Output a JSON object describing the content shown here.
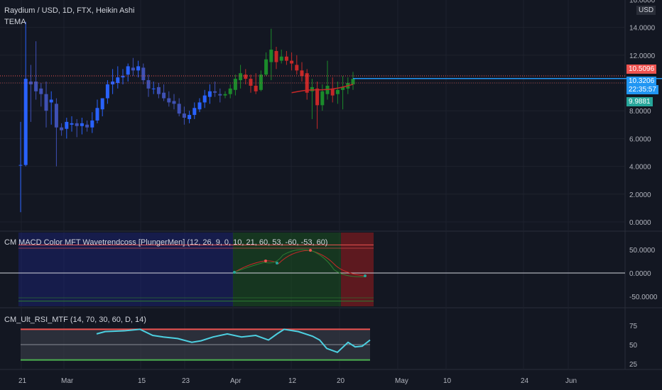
{
  "main": {
    "title": "Raydium / USD, 1D, FTX, Heikin Ashi",
    "indicator": "TEMA",
    "currency": "USD",
    "y_ticks": [
      "16.0000",
      "14.0000",
      "12.0000",
      "8.0000",
      "6.0000",
      "4.0000",
      "2.0000",
      "0.0000"
    ],
    "badges": {
      "upper": "10.5096",
      "price": "10.3206",
      "countdown": "22:35:57",
      "lower": "9.9881"
    },
    "colors": {
      "up": "#26a69a",
      "down": "#ef5350",
      "blue": "#2962ff",
      "green": "#1b8a2b",
      "red": "#d32f2f",
      "hline": "#2196f3"
    }
  },
  "macd": {
    "title": "CM MACD Color MFT Wavetrendcoss [PlungerMen] (12, 26, 9, 0, 10, 21, 60, 53, -60, -53, 60)",
    "y_ticks": [
      "50.0000",
      "0.0000",
      "-50.0000"
    ]
  },
  "rsi": {
    "title": "CM_Ult_RSI_MTF (14, 70, 30, 60, D, 14)",
    "y_ticks": [
      "75",
      "50",
      "25"
    ]
  },
  "x_ticks": [
    "21",
    "Mar",
    "15",
    "23",
    "Apr",
    "12",
    "20",
    "May",
    "10",
    "24",
    "Jun"
  ],
  "chart_data": {
    "type": "candlestick",
    "title": "Raydium / USD, 1D, FTX, Heikin Ashi",
    "ylim": [
      0,
      16
    ],
    "candles": [
      {
        "o": 4.1,
        "h": 7.2,
        "l": 0.7,
        "c": 4.1
      },
      {
        "o": 4.1,
        "h": 14.4,
        "l": 4.0,
        "c": 10.3
      },
      {
        "o": 10.1,
        "h": 11.3,
        "l": 7.2,
        "c": 9.9
      },
      {
        "o": 10.1,
        "h": 13.0,
        "l": 8.8,
        "c": 9.4
      },
      {
        "o": 9.6,
        "h": 10.0,
        "l": 8.3,
        "c": 9.2
      },
      {
        "o": 9.2,
        "h": 10.1,
        "l": 6.8,
        "c": 8.0
      },
      {
        "o": 8.6,
        "h": 9.4,
        "l": 7.0,
        "c": 8.8
      },
      {
        "o": 8.5,
        "h": 8.9,
        "l": 4.0,
        "c": 6.8
      },
      {
        "o": 6.8,
        "h": 7.1,
        "l": 6.2,
        "c": 6.6
      },
      {
        "o": 6.7,
        "h": 7.5,
        "l": 6.0,
        "c": 7.2
      },
      {
        "o": 7.0,
        "h": 7.6,
        "l": 6.5,
        "c": 7.1
      },
      {
        "o": 7.1,
        "h": 7.4,
        "l": 6.1,
        "c": 6.9
      },
      {
        "o": 6.9,
        "h": 7.5,
        "l": 6.3,
        "c": 7.1
      },
      {
        "o": 7.0,
        "h": 7.3,
        "l": 6.5,
        "c": 6.8
      },
      {
        "o": 6.8,
        "h": 7.9,
        "l": 6.4,
        "c": 7.3
      },
      {
        "o": 7.3,
        "h": 8.8,
        "l": 7.1,
        "c": 8.2
      },
      {
        "o": 8.1,
        "h": 8.9,
        "l": 7.6,
        "c": 8.9
      },
      {
        "o": 8.9,
        "h": 10.2,
        "l": 8.5,
        "c": 9.9
      },
      {
        "o": 9.9,
        "h": 11.0,
        "l": 9.2,
        "c": 10.1
      },
      {
        "o": 10.0,
        "h": 11.2,
        "l": 9.6,
        "c": 10.4
      },
      {
        "o": 10.4,
        "h": 11.0,
        "l": 9.9,
        "c": 10.5
      },
      {
        "o": 10.6,
        "h": 11.4,
        "l": 10.1,
        "c": 11.2
      },
      {
        "o": 11.1,
        "h": 11.8,
        "l": 10.5,
        "c": 10.9
      },
      {
        "o": 10.9,
        "h": 11.6,
        "l": 10.4,
        "c": 11.2
      },
      {
        "o": 11.1,
        "h": 11.4,
        "l": 9.9,
        "c": 10.2
      },
      {
        "o": 10.2,
        "h": 10.6,
        "l": 9.0,
        "c": 9.6
      },
      {
        "o": 9.6,
        "h": 10.1,
        "l": 9.2,
        "c": 9.6
      },
      {
        "o": 9.7,
        "h": 10.0,
        "l": 8.9,
        "c": 9.2
      },
      {
        "o": 9.3,
        "h": 9.9,
        "l": 8.7,
        "c": 8.9
      },
      {
        "o": 8.9,
        "h": 9.4,
        "l": 8.3,
        "c": 8.6
      },
      {
        "o": 8.7,
        "h": 9.2,
        "l": 8.1,
        "c": 8.5
      },
      {
        "o": 8.5,
        "h": 8.9,
        "l": 7.6,
        "c": 7.8
      },
      {
        "o": 7.8,
        "h": 8.3,
        "l": 7.0,
        "c": 7.5
      },
      {
        "o": 7.4,
        "h": 8.0,
        "l": 7.1,
        "c": 7.7
      },
      {
        "o": 7.7,
        "h": 8.6,
        "l": 7.4,
        "c": 8.2
      },
      {
        "o": 8.1,
        "h": 8.9,
        "l": 7.9,
        "c": 8.6
      },
      {
        "o": 8.6,
        "h": 9.5,
        "l": 8.2,
        "c": 9.1
      },
      {
        "o": 9.0,
        "h": 9.9,
        "l": 8.5,
        "c": 9.4
      },
      {
        "o": 9.4,
        "h": 10.1,
        "l": 9.0,
        "c": 9.3
      },
      {
        "o": 9.2,
        "h": 9.6,
        "l": 8.6,
        "c": 9.1
      },
      {
        "o": 9.1,
        "h": 9.4,
        "l": 8.9,
        "c": 9.2
      },
      {
        "o": 9.2,
        "h": 9.9,
        "l": 8.9,
        "c": 9.6
      },
      {
        "o": 9.5,
        "h": 10.6,
        "l": 9.1,
        "c": 10.3
      },
      {
        "o": 10.2,
        "h": 11.3,
        "l": 9.6,
        "c": 10.7
      },
      {
        "o": 10.6,
        "h": 11.0,
        "l": 9.9,
        "c": 10.3
      },
      {
        "o": 10.3,
        "h": 10.6,
        "l": 9.3,
        "c": 9.8
      },
      {
        "o": 9.8,
        "h": 10.7,
        "l": 9.2,
        "c": 9.4
      },
      {
        "o": 9.5,
        "h": 10.9,
        "l": 9.4,
        "c": 10.6
      },
      {
        "o": 10.6,
        "h": 12.2,
        "l": 10.5,
        "c": 11.7
      },
      {
        "o": 11.5,
        "h": 13.9,
        "l": 10.2,
        "c": 12.4
      },
      {
        "o": 12.3,
        "h": 12.6,
        "l": 11.0,
        "c": 11.5
      },
      {
        "o": 11.6,
        "h": 12.4,
        "l": 11.4,
        "c": 11.9
      },
      {
        "o": 11.9,
        "h": 12.3,
        "l": 11.3,
        "c": 11.6
      },
      {
        "o": 11.6,
        "h": 12.2,
        "l": 10.9,
        "c": 11.4
      },
      {
        "o": 11.3,
        "h": 12.0,
        "l": 10.6,
        "c": 10.9
      },
      {
        "o": 10.9,
        "h": 11.5,
        "l": 10.1,
        "c": 10.5
      },
      {
        "o": 10.7,
        "h": 11.0,
        "l": 8.8,
        "c": 9.3
      },
      {
        "o": 9.4,
        "h": 10.3,
        "l": 7.4,
        "c": 9.7
      },
      {
        "o": 9.6,
        "h": 10.1,
        "l": 6.7,
        "c": 8.4
      },
      {
        "o": 8.4,
        "h": 9.9,
        "l": 8.0,
        "c": 9.4
      },
      {
        "o": 9.2,
        "h": 11.6,
        "l": 8.8,
        "c": 9.8
      },
      {
        "o": 9.6,
        "h": 10.4,
        "l": 8.6,
        "c": 9.1
      },
      {
        "o": 9.2,
        "h": 10.1,
        "l": 8.5,
        "c": 9.5
      },
      {
        "o": 9.5,
        "h": 10.5,
        "l": 8.1,
        "c": 9.7
      },
      {
        "o": 9.6,
        "h": 10.4,
        "l": 9.2,
        "c": 10.0
      },
      {
        "o": 9.9,
        "h": 10.8,
        "l": 9.5,
        "c": 10.3
      }
    ],
    "tema": [
      {
        "i": 53,
        "v": 9.3
      },
      {
        "i": 56,
        "v": 9.5
      },
      {
        "i": 59,
        "v": 9.5
      },
      {
        "i": 62,
        "v": 9.6
      },
      {
        "i": 65,
        "v": 9.9
      }
    ],
    "current_price": 10.3206
  }
}
